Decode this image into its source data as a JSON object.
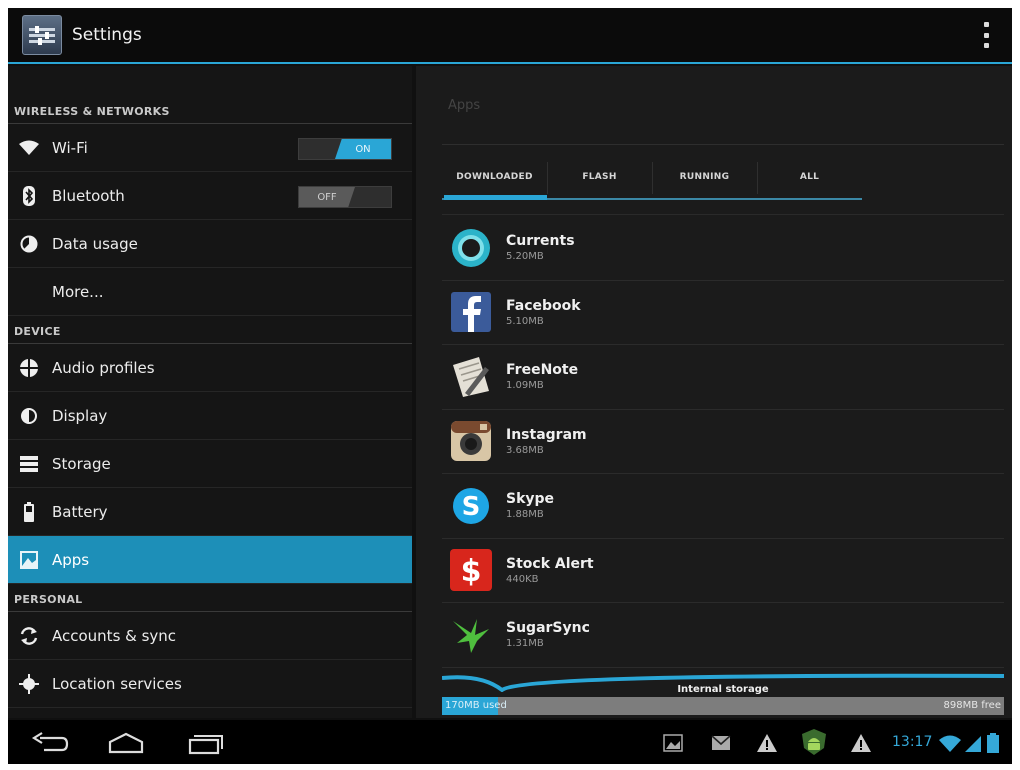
{
  "action_bar": {
    "title": "Settings"
  },
  "sidebar": {
    "sections": [
      {
        "header": "WIRELESS & NETWORKS",
        "items": [
          {
            "label": "Wi-Fi",
            "icon": "wifi-icon",
            "toggle": "ON"
          },
          {
            "label": "Bluetooth",
            "icon": "bluetooth-icon",
            "toggle": "OFF"
          },
          {
            "label": "Data usage",
            "icon": "data-usage-icon"
          },
          {
            "label": "More..."
          }
        ]
      },
      {
        "header": "DEVICE",
        "items": [
          {
            "label": "Audio profiles",
            "icon": "audio-profiles-icon"
          },
          {
            "label": "Display",
            "icon": "display-icon"
          },
          {
            "label": "Storage",
            "icon": "storage-icon"
          },
          {
            "label": "Battery",
            "icon": "battery-icon"
          },
          {
            "label": "Apps",
            "icon": "apps-icon",
            "selected": true
          }
        ]
      },
      {
        "header": "PERSONAL",
        "items": [
          {
            "label": "Accounts & sync",
            "icon": "sync-icon"
          },
          {
            "label": "Location services",
            "icon": "location-icon"
          }
        ]
      }
    ]
  },
  "apps_pane": {
    "title": "Apps",
    "tabs": [
      "DOWNLOADED",
      "FLASH",
      "RUNNING",
      "ALL"
    ],
    "active_tab": "DOWNLOADED",
    "apps": [
      {
        "name": "Currents",
        "size": "5.20MB",
        "icon": "currents-icon"
      },
      {
        "name": "Facebook",
        "size": "5.10MB",
        "icon": "facebook-icon"
      },
      {
        "name": "FreeNote",
        "size": "1.09MB",
        "icon": "freenote-icon"
      },
      {
        "name": "Instagram",
        "size": "3.68MB",
        "icon": "instagram-icon"
      },
      {
        "name": "Skype",
        "size": "1.88MB",
        "icon": "skype-icon"
      },
      {
        "name": "Stock Alert",
        "size": "440KB",
        "icon": "stock-alert-icon"
      },
      {
        "name": "SugarSync",
        "size": "1.31MB",
        "icon": "sugarsync-icon"
      }
    ],
    "storage": {
      "label": "Internal storage",
      "used": "170MB used",
      "free": "898MB free",
      "used_fraction": 0.1
    }
  },
  "system_bar": {
    "clock": "13:17",
    "nav": [
      "back-icon",
      "home-icon",
      "recent-apps-icon"
    ],
    "notifications": [
      "gallery-icon",
      "email-icon",
      "warning-icon",
      "android-icon",
      "warning-icon"
    ]
  },
  "colors": {
    "accent": "#2aa6d6",
    "background": "#151515"
  }
}
